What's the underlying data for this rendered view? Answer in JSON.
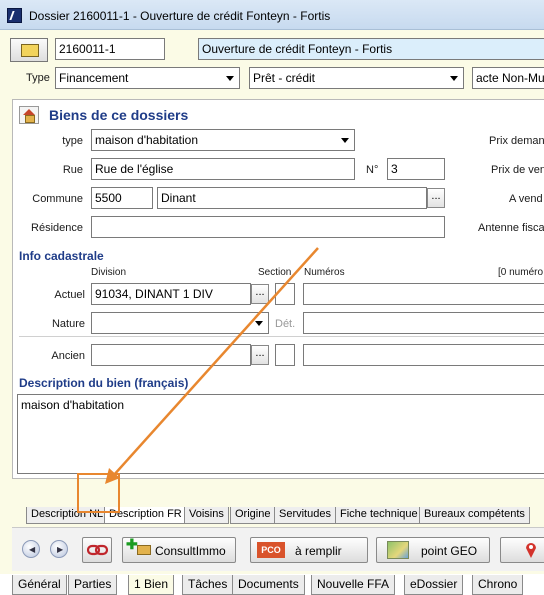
{
  "window": {
    "title": "Dossier 2160011-1 - Ouverture de crédit Fonteyn - Fortis"
  },
  "dossier": {
    "number": "2160011-1",
    "name": "Ouverture de crédit Fonteyn - Fortis",
    "type_label": "Type",
    "type_value": "Financement",
    "subtype_value": "Prêt - crédit",
    "acte_value": "acte Non-Mu"
  },
  "section": {
    "title": "Biens de ce dossiers",
    "type_label": "type",
    "type_value": "maison d'habitation",
    "rue_label": "Rue",
    "rue_value": "Rue de l'église",
    "num_label": "N°",
    "num_value": "3",
    "commune_label": "Commune",
    "postal_value": "5500",
    "commune_value": "Dinant",
    "residence_label": "Résidence",
    "residence_value": "",
    "right_labels": [
      "Prix demand",
      "Prix de ven",
      "A vend",
      "Antenne fisca"
    ]
  },
  "cadastre": {
    "title": "Info cadastrale",
    "division_label": "Division",
    "section_label": "Section",
    "numeros_label": "Numéros",
    "count_label": "[0 numéro",
    "actuel_label": "Actuel",
    "actuel_value": "91034, DINANT  1 DIV",
    "nature_label": "Nature",
    "det_label": "Dét.",
    "ancien_label": "Ancien"
  },
  "description": {
    "title": "Description du bien (français)",
    "text": "maison d'habitation"
  },
  "subtabs": [
    "Description NL",
    "Description FR",
    "Voisins",
    "Origine",
    "Servitudes",
    "Fiche technique",
    "Bureaux compétents"
  ],
  "toolbar": {
    "consult": "ConsultImmo",
    "pco": "PCO",
    "remplir": "à remplir",
    "geo": "point GEO"
  },
  "bottomtabs": [
    "Général",
    "Parties",
    "1 Bien",
    "Tâches",
    "Documents",
    "Nouvelle FFA",
    "eDossier",
    "Chrono"
  ],
  "colors": {
    "accent": "#1f3c88",
    "highlight": "#e8872f",
    "background": "#fbfbe6"
  }
}
